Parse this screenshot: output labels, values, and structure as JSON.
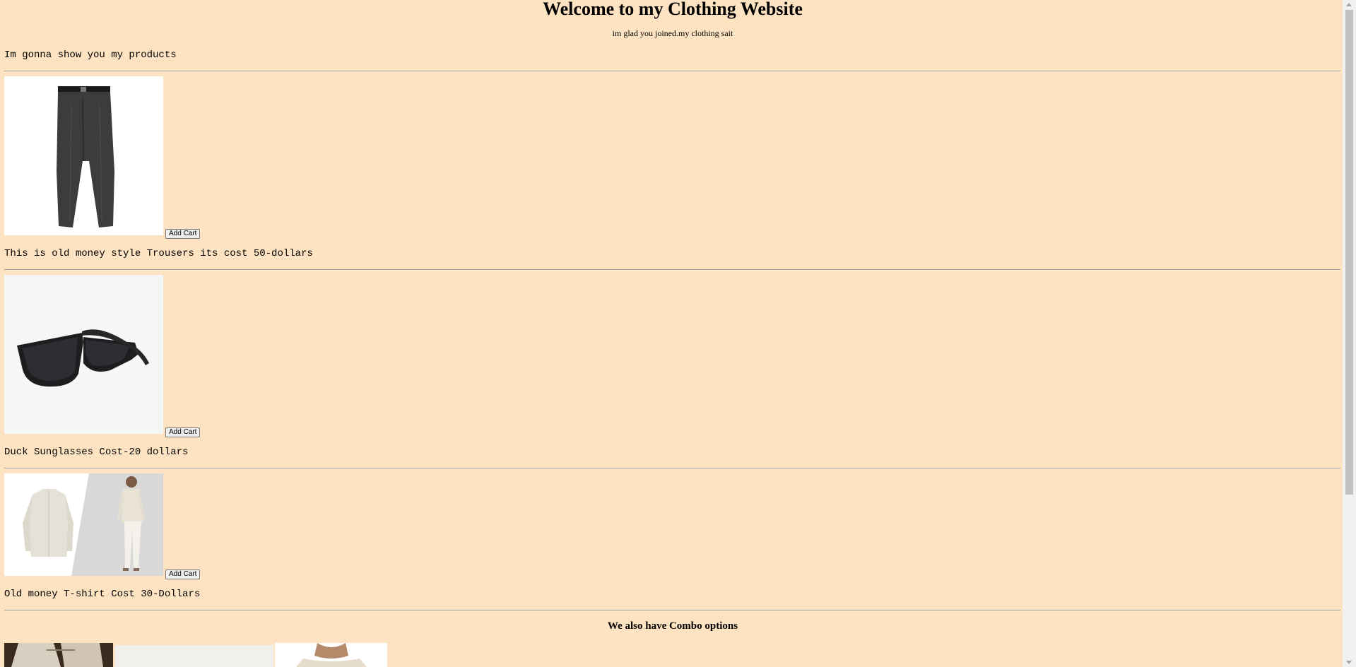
{
  "header": {
    "title": "Welcome to my Clothing Website",
    "subtitle": "im glad you joined.my clothing sait",
    "intro": "Im gonna show you my products"
  },
  "products": [
    {
      "image_icon": "trousers-image",
      "button_label": "Add Cart",
      "description": "This is old money style Trousers its cost 50-dollars"
    },
    {
      "image_icon": "sunglasses-image",
      "button_label": "Add Cart",
      "description": "Duck Sunglasses Cost-20 dollars"
    },
    {
      "image_icon": "shirt-image",
      "button_label": "Add Cart",
      "description": "Old money T-shirt Cost 30-Dollars"
    }
  ],
  "combo": {
    "title": "We also have Combo options"
  },
  "colors": {
    "background": "#fde3c1",
    "button": "#efefef"
  }
}
